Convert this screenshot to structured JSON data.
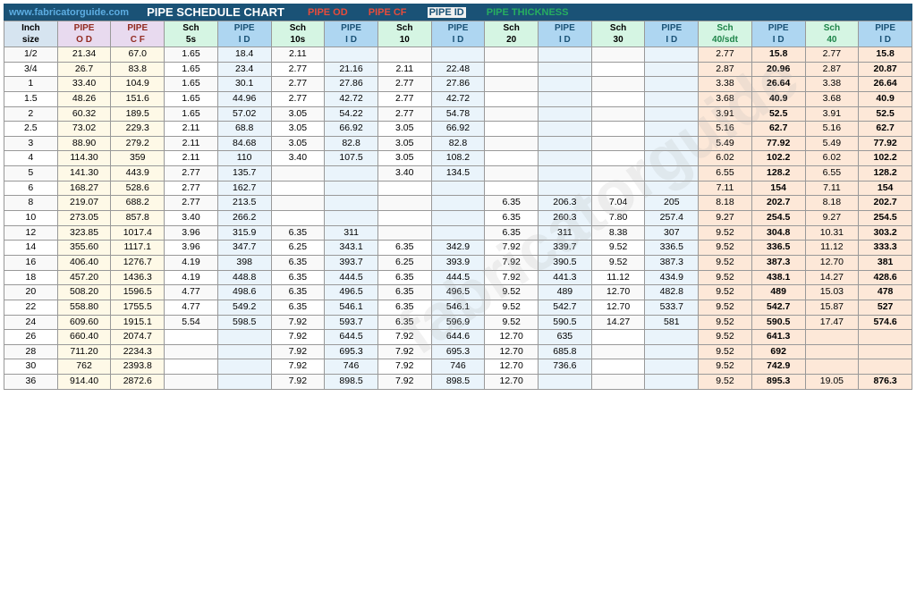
{
  "header": {
    "site": "www.fabricatorguide.com",
    "title": "PIPE SCHEDULE CHART",
    "labels": [
      "PIPE OD",
      "PIPE CF",
      "PIPE ID",
      "PIPE THICKNESS"
    ],
    "watermark": "fabricatorguide"
  },
  "columns": [
    {
      "key": "inch",
      "label": "Inch\nsize",
      "class": "header-inch"
    },
    {
      "key": "pipe_od",
      "label": "PIPE\nO D",
      "class": "header-od"
    },
    {
      "key": "pipe_cf",
      "label": "PIPE\nC F",
      "class": "header-cf"
    },
    {
      "key": "sch5s",
      "label": "Sch\n5s",
      "class": "header-sch"
    },
    {
      "key": "pipe_id_5s",
      "label": "PIPE\nI D",
      "class": "header-id"
    },
    {
      "key": "sch10s",
      "label": "Sch\n10s",
      "class": "header-sch"
    },
    {
      "key": "pipe_id_10s",
      "label": "PIPE\nI D",
      "class": "header-id"
    },
    {
      "key": "sch10",
      "label": "Sch\n10",
      "class": "header-sch"
    },
    {
      "key": "pipe_id_10",
      "label": "PIPE\nI D",
      "class": "header-id"
    },
    {
      "key": "sch20",
      "label": "Sch\n20",
      "class": "header-sch"
    },
    {
      "key": "pipe_id_20",
      "label": "PIPE\nI D",
      "class": "header-id"
    },
    {
      "key": "sch30",
      "label": "Sch\n30",
      "class": "header-sch"
    },
    {
      "key": "pipe_id_30",
      "label": "PIPE\nI D",
      "class": "header-id"
    },
    {
      "key": "sch40sdt",
      "label": "Sch\n40/sdt",
      "class": "header-thick"
    },
    {
      "key": "pipe_id_40sdt",
      "label": "PIPE\nI D",
      "class": "header-id"
    },
    {
      "key": "sch40",
      "label": "Sch\n40",
      "class": "header-thick"
    },
    {
      "key": "pipe_id_40",
      "label": "PIPE\nI D",
      "class": "header-id"
    }
  ],
  "rows": [
    {
      "inch": "1/2",
      "pipe_od": "21.34",
      "pipe_cf": "67.0",
      "sch5s": "1.65",
      "pipe_id_5s": "18.4",
      "sch10s": "2.11",
      "pipe_id_10s": "",
      "sch10": "",
      "pipe_id_10": "",
      "sch20": "",
      "pipe_id_20": "",
      "sch30": "",
      "pipe_id_30": "",
      "sch40sdt": "2.77",
      "pipe_id_40sdt": "15.8",
      "sch40": "2.77",
      "pipe_id_40": "15.8"
    },
    {
      "inch": "3/4",
      "pipe_od": "26.7",
      "pipe_cf": "83.8",
      "sch5s": "1.65",
      "pipe_id_5s": "23.4",
      "sch10s": "2.77",
      "pipe_id_10s": "21.16",
      "sch10": "2.11",
      "pipe_id_10": "22.48",
      "sch20": "",
      "pipe_id_20": "",
      "sch30": "",
      "pipe_id_30": "",
      "sch40sdt": "2.87",
      "pipe_id_40sdt": "20.96",
      "sch40": "2.87",
      "pipe_id_40": "20.87"
    },
    {
      "inch": "1",
      "pipe_od": "33.40",
      "pipe_cf": "104.9",
      "sch5s": "1.65",
      "pipe_id_5s": "30.1",
      "sch10s": "2.77",
      "pipe_id_10s": "27.86",
      "sch10": "2.77",
      "pipe_id_10": "27.86",
      "sch20": "",
      "pipe_id_20": "",
      "sch30": "",
      "pipe_id_30": "",
      "sch40sdt": "3.38",
      "pipe_id_40sdt": "26.64",
      "sch40": "3.38",
      "pipe_id_40": "26.64"
    },
    {
      "inch": "1.5",
      "pipe_od": "48.26",
      "pipe_cf": "151.6",
      "sch5s": "1.65",
      "pipe_id_5s": "44.96",
      "sch10s": "2.77",
      "pipe_id_10s": "42.72",
      "sch10": "2.77",
      "pipe_id_10": "42.72",
      "sch20": "",
      "pipe_id_20": "",
      "sch30": "",
      "pipe_id_30": "",
      "sch40sdt": "3.68",
      "pipe_id_40sdt": "40.9",
      "sch40": "3.68",
      "pipe_id_40": "40.9"
    },
    {
      "inch": "2",
      "pipe_od": "60.32",
      "pipe_cf": "189.5",
      "sch5s": "1.65",
      "pipe_id_5s": "57.02",
      "sch10s": "3.05",
      "pipe_id_10s": "54.22",
      "sch10": "2.77",
      "pipe_id_10": "54.78",
      "sch20": "",
      "pipe_id_20": "",
      "sch30": "",
      "pipe_id_30": "",
      "sch40sdt": "3.91",
      "pipe_id_40sdt": "52.5",
      "sch40": "3.91",
      "pipe_id_40": "52.5"
    },
    {
      "inch": "2.5",
      "pipe_od": "73.02",
      "pipe_cf": "229.3",
      "sch5s": "2.11",
      "pipe_id_5s": "68.8",
      "sch10s": "3.05",
      "pipe_id_10s": "66.92",
      "sch10": "3.05",
      "pipe_id_10": "66.92",
      "sch20": "",
      "pipe_id_20": "",
      "sch30": "",
      "pipe_id_30": "",
      "sch40sdt": "5.16",
      "pipe_id_40sdt": "62.7",
      "sch40": "5.16",
      "pipe_id_40": "62.7"
    },
    {
      "inch": "3",
      "pipe_od": "88.90",
      "pipe_cf": "279.2",
      "sch5s": "2.11",
      "pipe_id_5s": "84.68",
      "sch10s": "3.05",
      "pipe_id_10s": "82.8",
      "sch10": "3.05",
      "pipe_id_10": "82.8",
      "sch20": "",
      "pipe_id_20": "",
      "sch30": "",
      "pipe_id_30": "",
      "sch40sdt": "5.49",
      "pipe_id_40sdt": "77.92",
      "sch40": "5.49",
      "pipe_id_40": "77.92"
    },
    {
      "inch": "4",
      "pipe_od": "114.30",
      "pipe_cf": "359",
      "sch5s": "2.11",
      "pipe_id_5s": "110",
      "sch10s": "3.40",
      "pipe_id_10s": "107.5",
      "sch10": "3.05",
      "pipe_id_10": "108.2",
      "sch20": "",
      "pipe_id_20": "",
      "sch30": "",
      "pipe_id_30": "",
      "sch40sdt": "6.02",
      "pipe_id_40sdt": "102.2",
      "sch40": "6.02",
      "pipe_id_40": "102.2"
    },
    {
      "inch": "5",
      "pipe_od": "141.30",
      "pipe_cf": "443.9",
      "sch5s": "2.77",
      "pipe_id_5s": "135.7",
      "sch10s": "",
      "pipe_id_10s": "",
      "sch10": "3.40",
      "pipe_id_10": "134.5",
      "sch20": "",
      "pipe_id_20": "",
      "sch30": "",
      "pipe_id_30": "",
      "sch40sdt": "6.55",
      "pipe_id_40sdt": "128.2",
      "sch40": "6.55",
      "pipe_id_40": "128.2"
    },
    {
      "inch": "6",
      "pipe_od": "168.27",
      "pipe_cf": "528.6",
      "sch5s": "2.77",
      "pipe_id_5s": "162.7",
      "sch10s": "",
      "pipe_id_10s": "",
      "sch10": "",
      "pipe_id_10": "",
      "sch20": "",
      "pipe_id_20": "",
      "sch30": "",
      "pipe_id_30": "",
      "sch40sdt": "7.11",
      "pipe_id_40sdt": "154",
      "sch40": "7.11",
      "pipe_id_40": "154"
    },
    {
      "inch": "8",
      "pipe_od": "219.07",
      "pipe_cf": "688.2",
      "sch5s": "2.77",
      "pipe_id_5s": "213.5",
      "sch10s": "",
      "pipe_id_10s": "",
      "sch10": "",
      "pipe_id_10": "",
      "sch20": "6.35",
      "pipe_id_20": "206.3",
      "sch30": "7.04",
      "pipe_id_30": "205",
      "sch40sdt": "8.18",
      "pipe_id_40sdt": "202.7",
      "sch40": "8.18",
      "pipe_id_40": "202.7"
    },
    {
      "inch": "10",
      "pipe_od": "273.05",
      "pipe_cf": "857.8",
      "sch5s": "3.40",
      "pipe_id_5s": "266.2",
      "sch10s": "",
      "pipe_id_10s": "",
      "sch10": "",
      "pipe_id_10": "",
      "sch20": "6.35",
      "pipe_id_20": "260.3",
      "sch30": "7.80",
      "pipe_id_30": "257.4",
      "sch40sdt": "9.27",
      "pipe_id_40sdt": "254.5",
      "sch40": "9.27",
      "pipe_id_40": "254.5"
    },
    {
      "inch": "12",
      "pipe_od": "323.85",
      "pipe_cf": "1017.4",
      "sch5s": "3.96",
      "pipe_id_5s": "315.9",
      "sch10s": "6.35",
      "pipe_id_10s": "311",
      "sch10": "",
      "pipe_id_10": "",
      "sch20": "6.35",
      "pipe_id_20": "311",
      "sch30": "8.38",
      "pipe_id_30": "307",
      "sch40sdt": "9.52",
      "pipe_id_40sdt": "304.8",
      "sch40": "10.31",
      "pipe_id_40": "303.2"
    },
    {
      "inch": "14",
      "pipe_od": "355.60",
      "pipe_cf": "1117.1",
      "sch5s": "3.96",
      "pipe_id_5s": "347.7",
      "sch10s": "6.25",
      "pipe_id_10s": "343.1",
      "sch10": "6.35",
      "pipe_id_10": "342.9",
      "sch20": "7.92",
      "pipe_id_20": "339.7",
      "sch30": "9.52",
      "pipe_id_30": "336.5",
      "sch40sdt": "9.52",
      "pipe_id_40sdt": "336.5",
      "sch40": "11.12",
      "pipe_id_40": "333.3"
    },
    {
      "inch": "16",
      "pipe_od": "406.40",
      "pipe_cf": "1276.7",
      "sch5s": "4.19",
      "pipe_id_5s": "398",
      "sch10s": "6.35",
      "pipe_id_10s": "393.7",
      "sch10": "6.25",
      "pipe_id_10": "393.9",
      "sch20": "7.92",
      "pipe_id_20": "390.5",
      "sch30": "9.52",
      "pipe_id_30": "387.3",
      "sch40sdt": "9.52",
      "pipe_id_40sdt": "387.3",
      "sch40": "12.70",
      "pipe_id_40": "381"
    },
    {
      "inch": "18",
      "pipe_od": "457.20",
      "pipe_cf": "1436.3",
      "sch5s": "4.19",
      "pipe_id_5s": "448.8",
      "sch10s": "6.35",
      "pipe_id_10s": "444.5",
      "sch10": "6.35",
      "pipe_id_10": "444.5",
      "sch20": "7.92",
      "pipe_id_20": "441.3",
      "sch30": "11.12",
      "pipe_id_30": "434.9",
      "sch40sdt": "9.52",
      "pipe_id_40sdt": "438.1",
      "sch40": "14.27",
      "pipe_id_40": "428.6"
    },
    {
      "inch": "20",
      "pipe_od": "508.20",
      "pipe_cf": "1596.5",
      "sch5s": "4.77",
      "pipe_id_5s": "498.6",
      "sch10s": "6.35",
      "pipe_id_10s": "496.5",
      "sch10": "6.35",
      "pipe_id_10": "496.5",
      "sch20": "9.52",
      "pipe_id_20": "489",
      "sch30": "12.70",
      "pipe_id_30": "482.8",
      "sch40sdt": "9.52",
      "pipe_id_40sdt": "489",
      "sch40": "15.03",
      "pipe_id_40": "478"
    },
    {
      "inch": "22",
      "pipe_od": "558.80",
      "pipe_cf": "1755.5",
      "sch5s": "4.77",
      "pipe_id_5s": "549.2",
      "sch10s": "6.35",
      "pipe_id_10s": "546.1",
      "sch10": "6.35",
      "pipe_id_10": "546.1",
      "sch20": "9.52",
      "pipe_id_20": "542.7",
      "sch30": "12.70",
      "pipe_id_30": "533.7",
      "sch40sdt": "9.52",
      "pipe_id_40sdt": "542.7",
      "sch40": "15.87",
      "pipe_id_40": "527"
    },
    {
      "inch": "24",
      "pipe_od": "609.60",
      "pipe_cf": "1915.1",
      "sch5s": "5.54",
      "pipe_id_5s": "598.5",
      "sch10s": "7.92",
      "pipe_id_10s": "593.7",
      "sch10": "6.35",
      "pipe_id_10": "596.9",
      "sch20": "9.52",
      "pipe_id_20": "590.5",
      "sch30": "14.27",
      "pipe_id_30": "581",
      "sch40sdt": "9.52",
      "pipe_id_40sdt": "590.5",
      "sch40": "17.47",
      "pipe_id_40": "574.6"
    },
    {
      "inch": "26",
      "pipe_od": "660.40",
      "pipe_cf": "2074.7",
      "sch5s": "",
      "pipe_id_5s": "",
      "sch10s": "7.92",
      "pipe_id_10s": "644.5",
      "sch10": "7.92",
      "pipe_id_10": "644.6",
      "sch20": "12.70",
      "pipe_id_20": "635",
      "sch30": "",
      "pipe_id_30": "",
      "sch40sdt": "9.52",
      "pipe_id_40sdt": "641.3",
      "sch40": "",
      "pipe_id_40": ""
    },
    {
      "inch": "28",
      "pipe_od": "711.20",
      "pipe_cf": "2234.3",
      "sch5s": "",
      "pipe_id_5s": "",
      "sch10s": "7.92",
      "pipe_id_10s": "695.3",
      "sch10": "7.92",
      "pipe_id_10": "695.3",
      "sch20": "12.70",
      "pipe_id_20": "685.8",
      "sch30": "",
      "pipe_id_30": "",
      "sch40sdt": "9.52",
      "pipe_id_40sdt": "692",
      "sch40": "",
      "pipe_id_40": ""
    },
    {
      "inch": "30",
      "pipe_od": "762",
      "pipe_cf": "2393.8",
      "sch5s": "",
      "pipe_id_5s": "",
      "sch10s": "7.92",
      "pipe_id_10s": "746",
      "sch10": "7.92",
      "pipe_id_10": "746",
      "sch20": "12.70",
      "pipe_id_20": "736.6",
      "sch30": "",
      "pipe_id_30": "",
      "sch40sdt": "9.52",
      "pipe_id_40sdt": "742.9",
      "sch40": "",
      "pipe_id_40": ""
    },
    {
      "inch": "36",
      "pipe_od": "914.40",
      "pipe_cf": "2872.6",
      "sch5s": "",
      "pipe_id_5s": "",
      "sch10s": "7.92",
      "pipe_id_10s": "898.5",
      "sch10": "7.92",
      "pipe_id_10": "898.5",
      "sch20": "12.70",
      "pipe_id_20": "",
      "sch30": "",
      "pipe_id_30": "",
      "sch40sdt": "9.52",
      "pipe_id_40sdt": "895.3",
      "sch40": "19.05",
      "pipe_id_40": "876.3"
    }
  ]
}
